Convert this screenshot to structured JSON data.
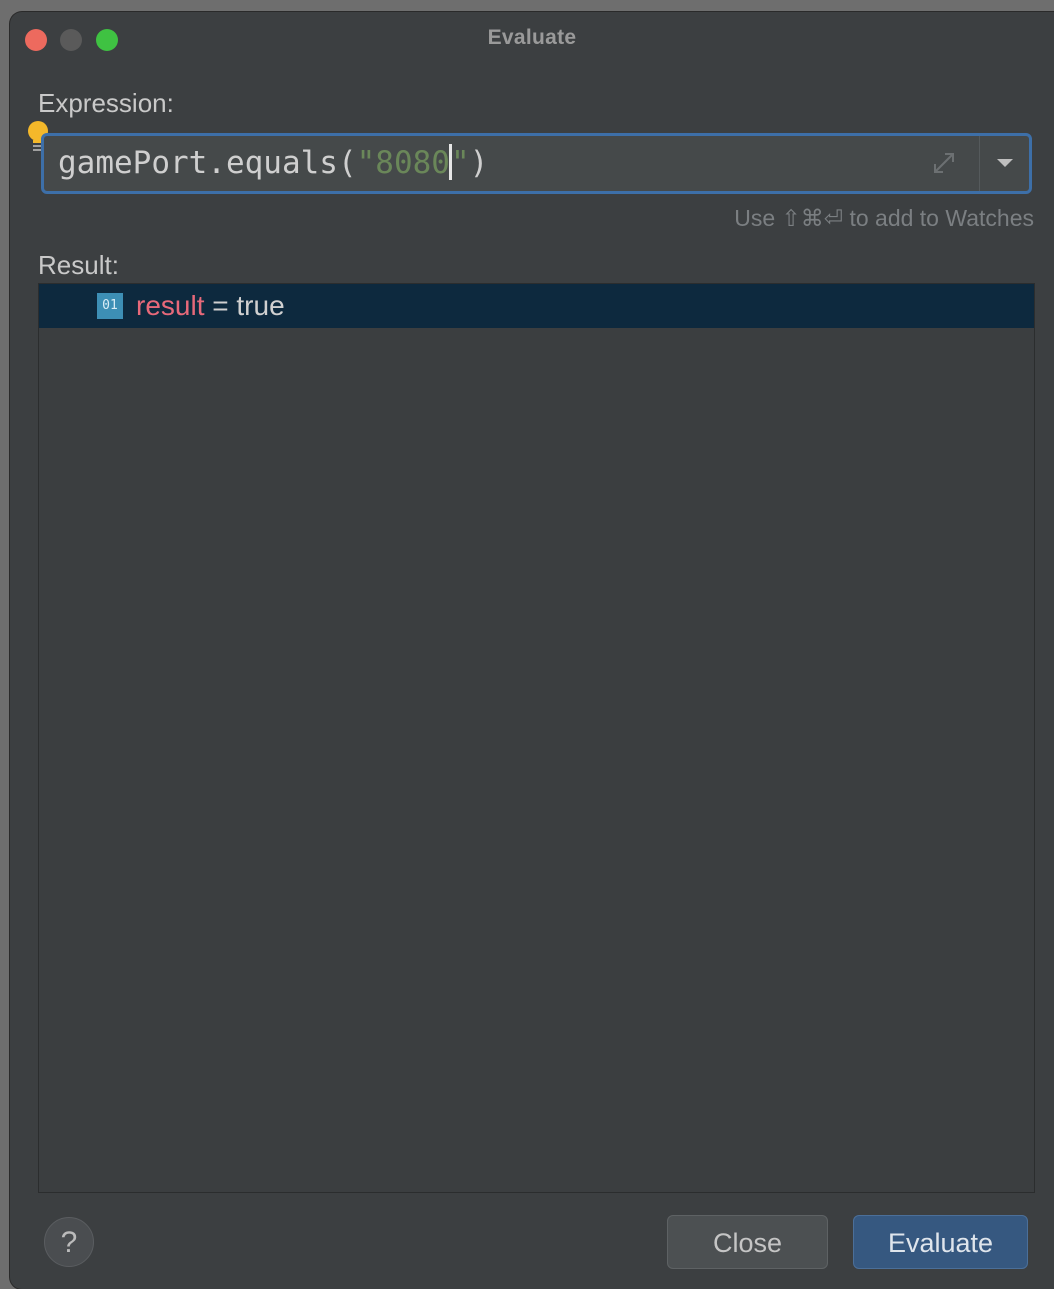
{
  "window": {
    "title": "Evaluate",
    "traffic_colors": {
      "close": "#ed6a5e",
      "minimize": "#5a5a5a",
      "maximize": "#3fc242"
    }
  },
  "expression": {
    "label": "Expression:",
    "code_prefix": "gamePort.equals(",
    "string_before_caret": "\"8080",
    "string_after_caret": "\"",
    "code_suffix": ")",
    "bulb_icon": "lightbulb-icon",
    "expand_icon": "expand-icon",
    "dropdown_icon": "chevron-down-icon"
  },
  "hint": {
    "text": "Use ⇧⌘⏎ to add to Watches"
  },
  "result": {
    "label": "Result:",
    "row": {
      "type_icon_text": "01",
      "name": "result",
      "separator": " = ",
      "value": "true"
    }
  },
  "buttons": {
    "help_label": "?",
    "close_label": "Close",
    "evaluate_label": "Evaluate"
  },
  "colors": {
    "accent_border": "#3d6fa8",
    "string_literal": "#6a8759",
    "variable_name": "#e7697a",
    "selected_row": "#0d293e",
    "primary_button": "#365880"
  }
}
